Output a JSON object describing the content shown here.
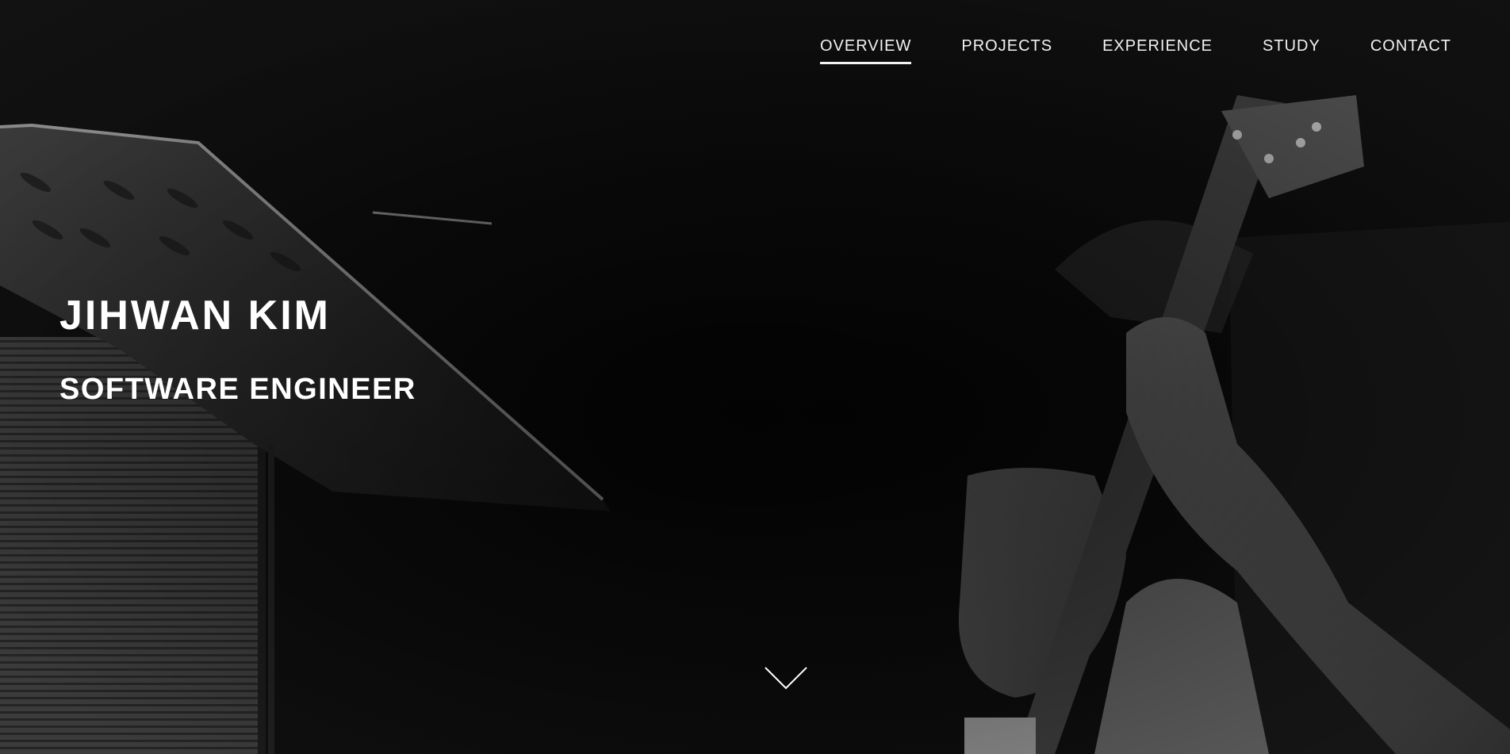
{
  "nav": {
    "items": [
      {
        "label": "OVERVIEW",
        "active": true
      },
      {
        "label": "PROJECTS",
        "active": false
      },
      {
        "label": "EXPERIENCE",
        "active": false
      },
      {
        "label": "STUDY",
        "active": false
      },
      {
        "label": "CONTACT",
        "active": false
      }
    ]
  },
  "hero": {
    "name": "JIHWAN KIM",
    "role": "SOFTWARE ENGINEER",
    "scroll_icon": "chevron-down-icon"
  },
  "colors": {
    "background": "#0b0b0b",
    "text": "#ffffff",
    "active_underline": "#f2f2f2"
  }
}
